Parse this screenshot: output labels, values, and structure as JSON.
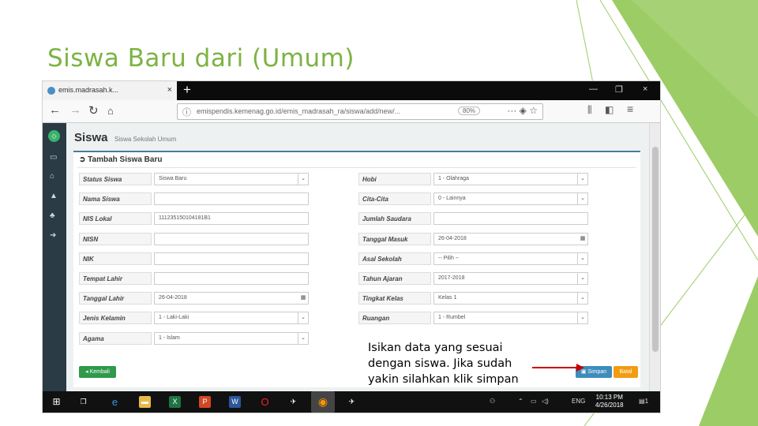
{
  "slide": {
    "title": "Siswa Baru dari (Umum)"
  },
  "browser": {
    "tab_title": "emis.madrasah.k...",
    "tab_close": "×",
    "new_tab": "+",
    "url": "emispendis.kemenag.go.id/emis_madrasah_ra/siswa/add/new/...",
    "zoom": "80%",
    "window_controls": {
      "minimize": "—",
      "restore": "❐",
      "close": "×"
    }
  },
  "app": {
    "page_title": "Siswa",
    "page_subtitle": "Siswa Sekolah Umum",
    "panel_title": "Tambah Siswa Baru",
    "left_fields": [
      {
        "label": "Status Siswa",
        "value": "Siswa Baru",
        "type": "select"
      },
      {
        "label": "Nama Siswa",
        "value": "",
        "type": "text"
      },
      {
        "label": "NIS Lokal",
        "value": "111235150104181B1",
        "type": "text"
      },
      {
        "label": "NISN",
        "value": "",
        "type": "text"
      },
      {
        "label": "NIK",
        "value": "",
        "type": "text"
      },
      {
        "label": "Tempat Lahir",
        "value": "",
        "type": "text"
      },
      {
        "label": "Tanggal Lahir",
        "value": "26-04-2018",
        "type": "date"
      },
      {
        "label": "Jenis Kelamin",
        "value": "1 - Laki-Laki",
        "type": "select"
      },
      {
        "label": "Agama",
        "value": "1 - Islam",
        "type": "select"
      }
    ],
    "right_fields": [
      {
        "label": "Hobi",
        "value": "1 - Olahraga",
        "type": "select"
      },
      {
        "label": "Cita-Cita",
        "value": "0 - Lainnya",
        "type": "select"
      },
      {
        "label": "Jumlah Saudara",
        "value": "",
        "type": "text"
      },
      {
        "label": "Tanggal Masuk",
        "value": "26-04-2018",
        "type": "date"
      },
      {
        "label": "Asal Sekolah",
        "value": "-- Pilih --",
        "type": "select"
      },
      {
        "label": "Tahun Ajaran",
        "value": "2017-2018",
        "type": "select"
      },
      {
        "label": "Tingkat Kelas",
        "value": "Kelas 1",
        "type": "select"
      },
      {
        "label": "Ruangan",
        "value": "1 - Rumbel",
        "type": "select"
      }
    ],
    "buttons": {
      "back": "Kembali",
      "save": "Simpan",
      "cancel": "Batal"
    },
    "colors": {
      "back": "#2e9a4a",
      "save": "#3c8dbc",
      "cancel": "#f39c12"
    }
  },
  "callout": {
    "lines": [
      "Isikan data yang sesuai",
      "dengan siswa. Jika sudah",
      "yakin silahkan klik simpan"
    ],
    "arrow_color": "#cc0000"
  },
  "taskbar": {
    "lang": "ENG",
    "time": "10:13 PM",
    "date": "4/26/2018",
    "notifications": "1"
  },
  "colors": {
    "title": "#7cb342",
    "accent": "#8bc34a"
  }
}
